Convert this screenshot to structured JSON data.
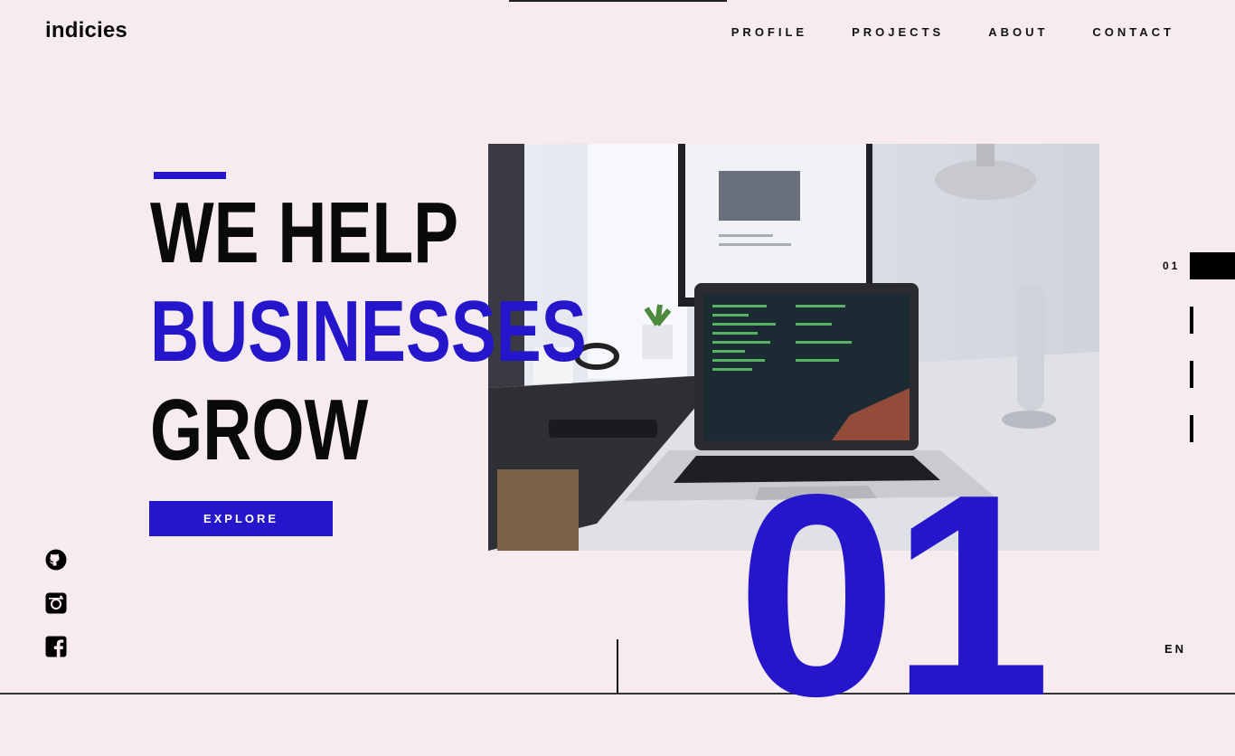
{
  "header": {
    "logo": "indicies",
    "nav": [
      "PROFILE",
      "PROJECTS",
      "ABOUT",
      "CONTACT"
    ]
  },
  "hero": {
    "line1": "WE HELP",
    "line2": "BUSINESSES",
    "line3": "GROW",
    "button": "EXPLORE",
    "big_number": "01",
    "image": "laptop-desk-photo"
  },
  "slider": {
    "current": "01",
    "count": 4
  },
  "social": [
    "github-icon",
    "instagram-icon",
    "facebook-icon"
  ],
  "language": "EN",
  "colors": {
    "accent": "#2516cc",
    "background": "#f6ecef",
    "text": "#0a0a0a"
  }
}
